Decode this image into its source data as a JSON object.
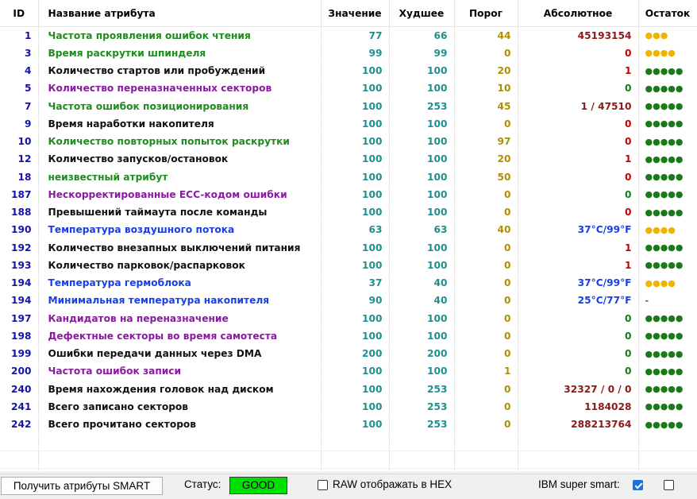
{
  "colors": {
    "green": "#1e8c1e",
    "purple": "#8a1aa0",
    "black": "#111111",
    "blue": "#1a3ee6",
    "dark_red": "#8b1a1a",
    "red": "#c80000",
    "teal": "#208f8f",
    "olive": "#b09000",
    "dots_green": "#1a7a1a",
    "dots_yellow": "#f0b400"
  },
  "headers": {
    "id": "ID",
    "name": "Название атрибута",
    "value": "Значение",
    "worst": "Худшее",
    "threshold": "Порог",
    "absolute": "Абсолютное",
    "remaining": "Остаток"
  },
  "rows": [
    {
      "id": "1",
      "name": "Частота проявления ошибок чтения",
      "name_color": "green",
      "value": "77",
      "worst": "66",
      "threshold": "44",
      "abs": "45193154",
      "abs_color": "dark_red",
      "rem": "●●●",
      "rem_color": "dots_yellow"
    },
    {
      "id": "3",
      "name": "Время раскрутки шпинделя",
      "name_color": "green",
      "value": "99",
      "worst": "99",
      "threshold": "0",
      "abs": "0",
      "abs_color": "red",
      "rem": "●●●●",
      "rem_color": "dots_yellow"
    },
    {
      "id": "4",
      "name": "Количество стартов или пробуждений",
      "name_color": "black",
      "value": "100",
      "worst": "100",
      "threshold": "20",
      "abs": "1",
      "abs_color": "red",
      "rem": "●●●●●",
      "rem_color": "dots_green"
    },
    {
      "id": "5",
      "name": "Количество переназначенных секторов",
      "name_color": "purple",
      "value": "100",
      "worst": "100",
      "threshold": "10",
      "abs": "0",
      "abs_color": "dots_green",
      "rem": "●●●●●",
      "rem_color": "dots_green"
    },
    {
      "id": "7",
      "name": "Частота ошибок позиционирования",
      "name_color": "green",
      "value": "100",
      "worst": "253",
      "threshold": "45",
      "abs": "1 / 47510",
      "abs_color": "dark_red",
      "rem": "●●●●●",
      "rem_color": "dots_green"
    },
    {
      "id": "9",
      "name": "Время наработки накопителя",
      "name_color": "black",
      "value": "100",
      "worst": "100",
      "threshold": "0",
      "abs": "0",
      "abs_color": "red",
      "rem": "●●●●●",
      "rem_color": "dots_green"
    },
    {
      "id": "10",
      "name": "Количество повторных попыток раскрутки",
      "name_color": "green",
      "value": "100",
      "worst": "100",
      "threshold": "97",
      "abs": "0",
      "abs_color": "red",
      "rem": "●●●●●",
      "rem_color": "dots_green"
    },
    {
      "id": "12",
      "name": "Количество запусков/остановок",
      "name_color": "black",
      "value": "100",
      "worst": "100",
      "threshold": "20",
      "abs": "1",
      "abs_color": "red",
      "rem": "●●●●●",
      "rem_color": "dots_green"
    },
    {
      "id": "18",
      "name": "неизвестный атрибут",
      "name_color": "green",
      "value": "100",
      "worst": "100",
      "threshold": "50",
      "abs": "0",
      "abs_color": "red",
      "rem": "●●●●●",
      "rem_color": "dots_green"
    },
    {
      "id": "187",
      "name": "Нескорректированные ECC-кодом ошибки",
      "name_color": "purple",
      "value": "100",
      "worst": "100",
      "threshold": "0",
      "abs": "0",
      "abs_color": "dots_green",
      "rem": "●●●●●",
      "rem_color": "dots_green"
    },
    {
      "id": "188",
      "name": "Превышений таймаута после команды",
      "name_color": "black",
      "value": "100",
      "worst": "100",
      "threshold": "0",
      "abs": "0",
      "abs_color": "red",
      "rem": "●●●●●",
      "rem_color": "dots_green"
    },
    {
      "id": "190",
      "name": "Температура воздушного потока",
      "name_color": "blue",
      "value": "63",
      "worst": "63",
      "threshold": "40",
      "abs": "37°C/99°F",
      "abs_color": "blue",
      "rem": "●●●●",
      "rem_color": "dots_yellow"
    },
    {
      "id": "192",
      "name": "Количество внезапных выключений питания",
      "name_color": "black",
      "value": "100",
      "worst": "100",
      "threshold": "0",
      "abs": "1",
      "abs_color": "red",
      "rem": "●●●●●",
      "rem_color": "dots_green"
    },
    {
      "id": "193",
      "name": "Количество парковок/распарковок",
      "name_color": "black",
      "value": "100",
      "worst": "100",
      "threshold": "0",
      "abs": "1",
      "abs_color": "red",
      "rem": "●●●●●",
      "rem_color": "dots_green"
    },
    {
      "id": "194",
      "name": "Температура гермоблока",
      "name_color": "blue",
      "value": "37",
      "worst": "40",
      "threshold": "0",
      "abs": "37°C/99°F",
      "abs_color": "blue",
      "rem": "●●●●",
      "rem_color": "dots_yellow"
    },
    {
      "id": "194",
      "name": "Минимальная температура накопителя",
      "name_color": "blue",
      "value": "90",
      "worst": "40",
      "threshold": "0",
      "abs": "25°C/77°F",
      "abs_color": "blue",
      "rem": "-",
      "rem_color": "dots_green"
    },
    {
      "id": "197",
      "name": "Кандидатов на переназначение",
      "name_color": "purple",
      "value": "100",
      "worst": "100",
      "threshold": "0",
      "abs": "0",
      "abs_color": "dots_green",
      "rem": "●●●●●",
      "rem_color": "dots_green"
    },
    {
      "id": "198",
      "name": "Дефектные секторы во время самотеста",
      "name_color": "purple",
      "value": "100",
      "worst": "100",
      "threshold": "0",
      "abs": "0",
      "abs_color": "dots_green",
      "rem": "●●●●●",
      "rem_color": "dots_green"
    },
    {
      "id": "199",
      "name": "Ошибки передачи данных через DMA",
      "name_color": "black",
      "value": "200",
      "worst": "200",
      "threshold": "0",
      "abs": "0",
      "abs_color": "dots_green",
      "rem": "●●●●●",
      "rem_color": "dots_green"
    },
    {
      "id": "200",
      "name": "Частота ошибок записи",
      "name_color": "purple",
      "value": "100",
      "worst": "100",
      "threshold": "1",
      "abs": "0",
      "abs_color": "dots_green",
      "rem": "●●●●●",
      "rem_color": "dots_green"
    },
    {
      "id": "240",
      "name": "Время нахождения головок над диском",
      "name_color": "black",
      "value": "100",
      "worst": "253",
      "threshold": "0",
      "abs": "32327 / 0 / 0",
      "abs_color": "dark_red",
      "rem": "●●●●●",
      "rem_color": "dots_green"
    },
    {
      "id": "241",
      "name": "Всего записано секторов",
      "name_color": "black",
      "value": "100",
      "worst": "253",
      "threshold": "0",
      "abs": "1184028",
      "abs_color": "dark_red",
      "rem": "●●●●●",
      "rem_color": "dots_green"
    },
    {
      "id": "242",
      "name": "Всего прочитано секторов",
      "name_color": "black",
      "value": "100",
      "worst": "253",
      "threshold": "0",
      "abs": "288213764",
      "abs_color": "dark_red",
      "rem": "●●●●●",
      "rem_color": "dots_green"
    }
  ],
  "empty_rows": 3,
  "footer": {
    "get_button": "Получить атрибуты SMART",
    "status_label": "Статус:",
    "status_value": "GOOD",
    "status_color": "#00e000",
    "raw_hex_label": "RAW отображать в HEX",
    "raw_hex_checked": false,
    "ibm_label": "IBM super smart:",
    "ibm_checked": true,
    "extra_checked": false
  }
}
